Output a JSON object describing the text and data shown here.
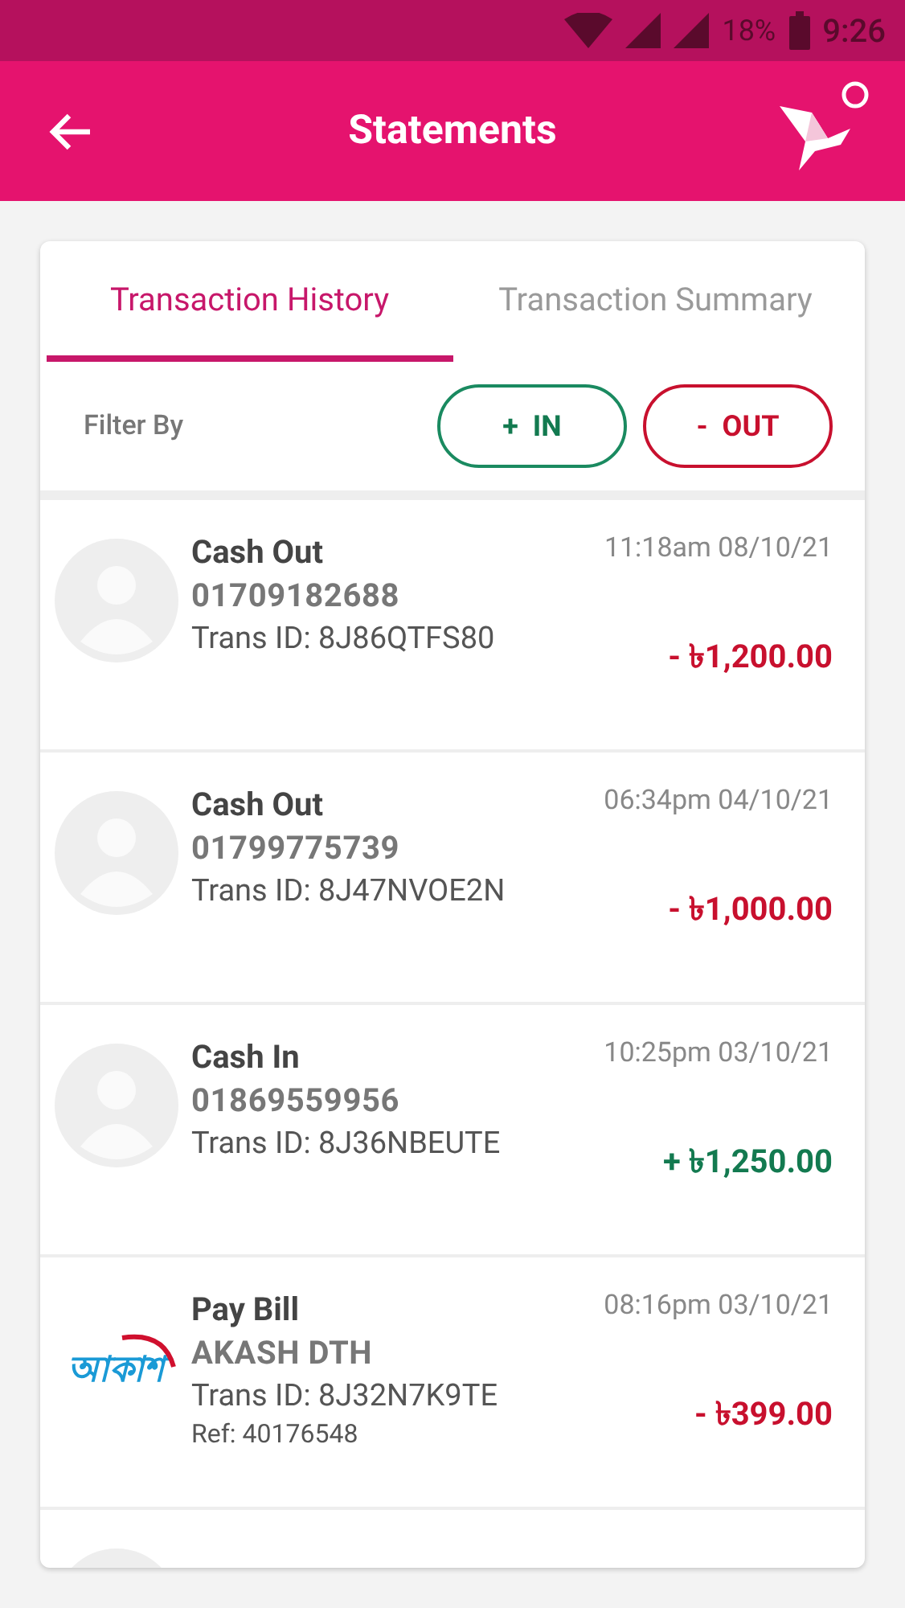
{
  "status_bar": {
    "battery": "18%",
    "time": "9:26"
  },
  "header": {
    "title": "Statements"
  },
  "tabs": [
    {
      "label": "Transaction History",
      "selected": true
    },
    {
      "label": "Transaction Summary",
      "selected": false
    }
  ],
  "filter": {
    "label": "Filter By",
    "buttons": [
      {
        "label": "+  IN",
        "kind": "in"
      },
      {
        "label": "-  OUT",
        "kind": "out"
      }
    ]
  },
  "transactions": [
    {
      "kind": "avatar",
      "type": "Cash Out",
      "party": "01709182688",
      "trans_id": "Trans ID: 8J86QTFS80",
      "time": "11:18am 08/10/21",
      "amount": "- ৳1,200.00",
      "incoming": false
    },
    {
      "kind": "avatar",
      "type": "Cash Out",
      "party": "01799775739",
      "trans_id": "Trans ID: 8J47NVOE2N",
      "time": "06:34pm 04/10/21",
      "amount": "- ৳1,000.00",
      "incoming": false
    },
    {
      "kind": "avatar",
      "type": "Cash In",
      "party": "01869559956",
      "trans_id": "Trans ID: 8J36NBEUTE",
      "time": "10:25pm 03/10/21",
      "amount": "+ ৳1,250.00",
      "incoming": true
    },
    {
      "kind": "brand",
      "logo_text": "আকাশ",
      "type": "Pay Bill",
      "party": "AKASH DTH",
      "trans_id": "Trans ID: 8J32N7K9TE",
      "ref": "Ref: 40176548",
      "time": "08:16pm 03/10/21",
      "amount": "- ৳399.00",
      "incoming": false
    },
    {
      "kind": "avatar",
      "partial": true
    }
  ]
}
